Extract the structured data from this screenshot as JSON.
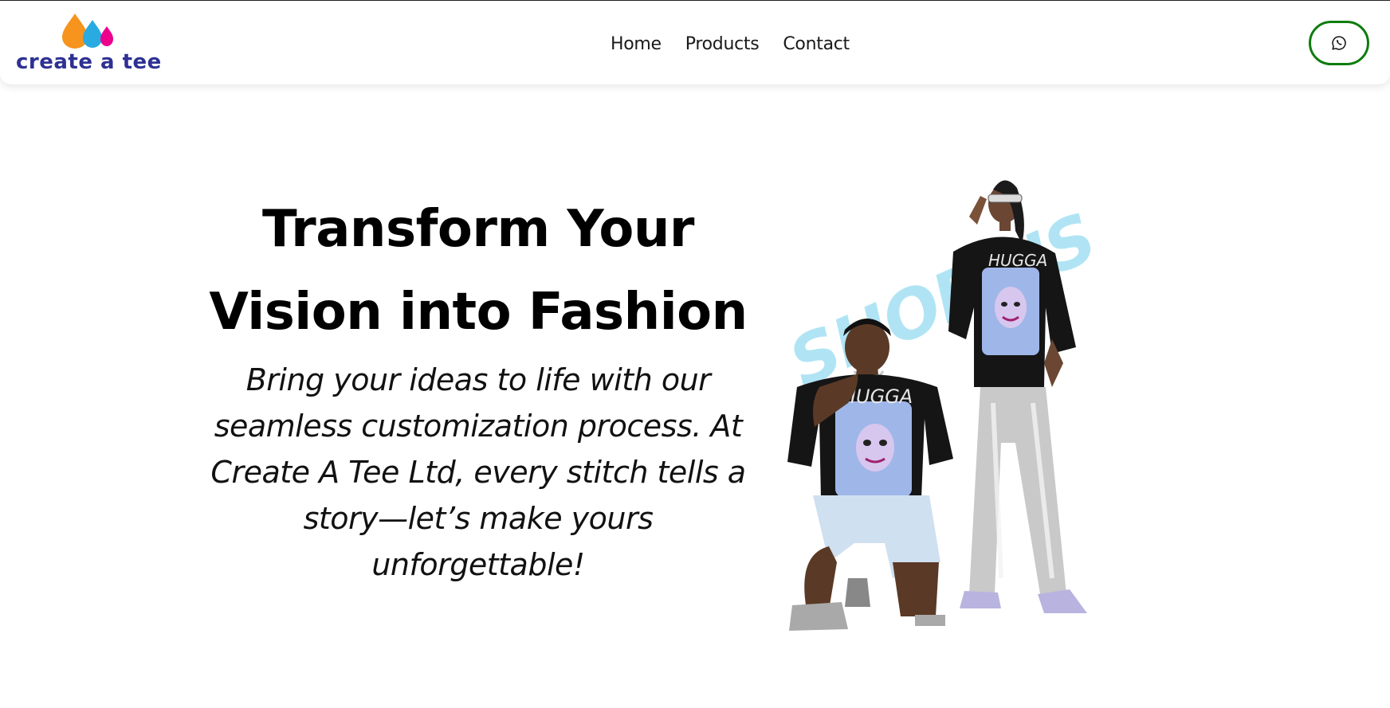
{
  "brand": {
    "name": "create a tee",
    "colors": {
      "orange": "#f7941d",
      "blue": "#29abe2",
      "pink": "#ec008c",
      "navy": "#2e3192"
    }
  },
  "nav": {
    "items": [
      {
        "label": "Home"
      },
      {
        "label": "Products"
      },
      {
        "label": "Contact"
      }
    ]
  },
  "whatsapp": {
    "icon": "whatsapp-icon",
    "border_color": "#0e7c0e"
  },
  "hero": {
    "title": "Transform Your Vision into Fashion",
    "subtitle": "Bring your ideas to life with our seamless customization process. At Create A Tee Ltd, every stitch tells a story—let’s make yours unforgettable!",
    "image": {
      "brush_text": "SHOP US",
      "brush_color": "#a8e2f5",
      "shirt_print": "HUGGA"
    }
  }
}
